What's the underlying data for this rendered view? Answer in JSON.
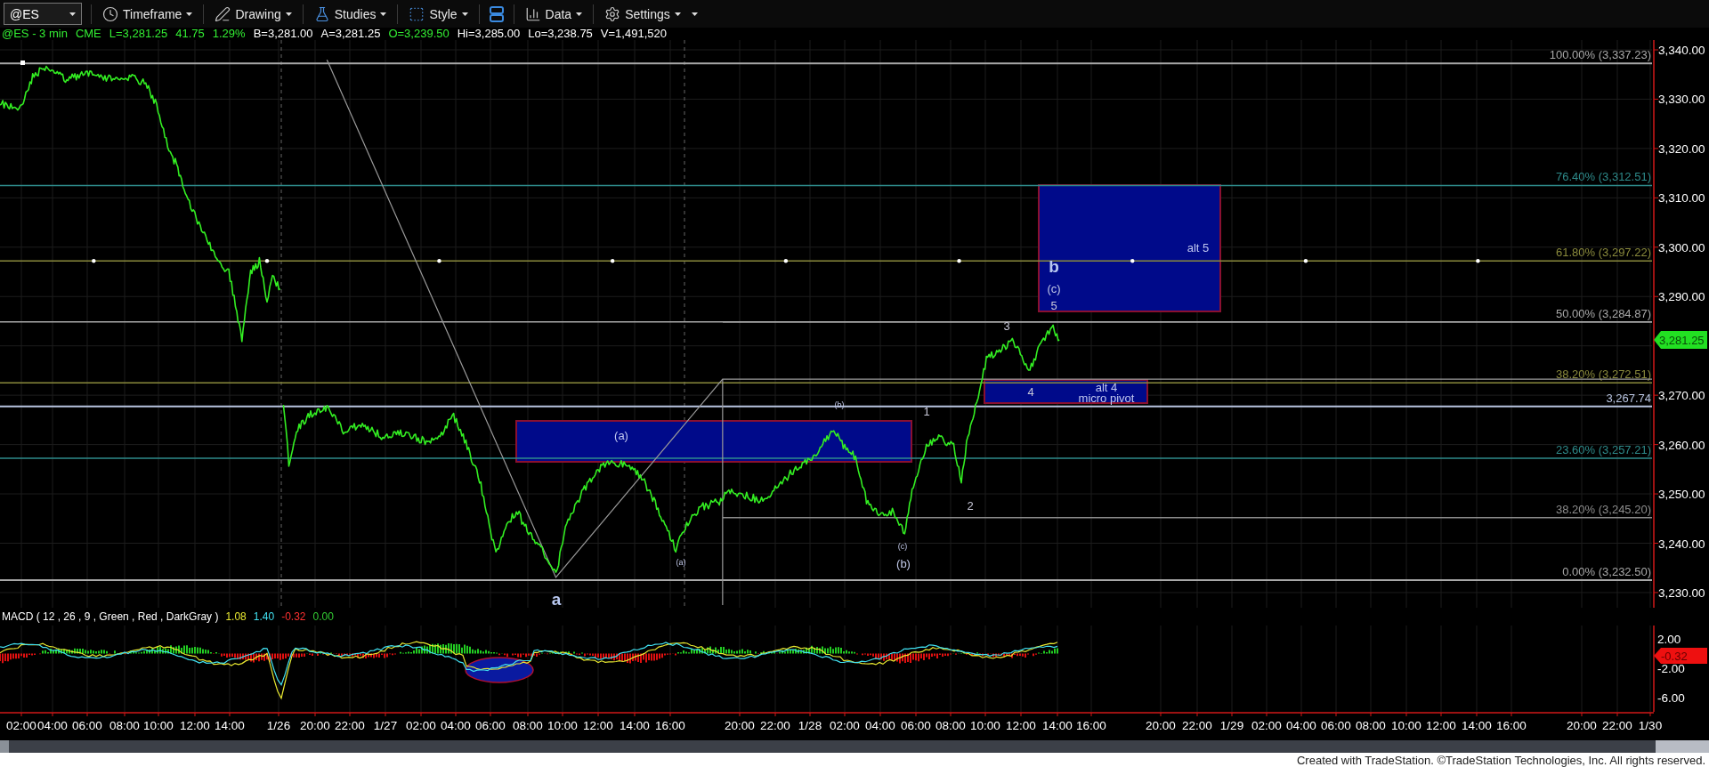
{
  "toolbar": {
    "symbol": "@ES",
    "menus": [
      {
        "label": "Timeframe",
        "kind": "clock"
      },
      {
        "label": "Drawing",
        "kind": "pen"
      },
      {
        "label": "Studies",
        "kind": "flask"
      },
      {
        "label": "Style",
        "kind": "style"
      },
      {
        "label": "Data",
        "kind": "bars"
      },
      {
        "label": "Settings",
        "kind": "gear"
      }
    ]
  },
  "quote": [
    {
      "text": "@ES - 3 min",
      "color": "#33ee33"
    },
    {
      "text": "CME",
      "color": "#33ee33"
    },
    {
      "text": "L=3,281.25",
      "color": "#33ee33"
    },
    {
      "text": "41.75",
      "color": "#33ee33"
    },
    {
      "text": "1.29%",
      "color": "#33ee33"
    },
    {
      "text": "B=3,281.00",
      "color": "#ffffff"
    },
    {
      "text": "A=3,281.25",
      "color": "#ffffff"
    },
    {
      "text": "O=3,239.50",
      "color": "#33ee33"
    },
    {
      "text": "Hi=3,285.00",
      "color": "#ffffff"
    },
    {
      "text": "Lo=3,238.75",
      "color": "#ffffff"
    },
    {
      "text": "V=1,491,520",
      "color": "#ffffff"
    }
  ],
  "chart": {
    "fib_levels": [
      {
        "label": "100.00% (3,337.23)",
        "color": "#a8a8a8"
      },
      {
        "label": "76.40% (3,312.51)",
        "color": "#2e8b8b"
      },
      {
        "label": "61.80% (3,297.22)",
        "color": "#8a8a3c"
      },
      {
        "label": "50.00% (3,284.87)",
        "color": "#a8a8a8"
      },
      {
        "label": "38.20% (3,272.51)",
        "color": "#8a8a3c"
      },
      {
        "label": "3,267.74",
        "color": "#b8c4e0"
      },
      {
        "label": "23.60% (3,257.21)",
        "color": "#2e8b8b"
      },
      {
        "label": "38.20% (3,245.20)",
        "color": "#8c8c8c"
      },
      {
        "label": "0.00% (3,232.50)",
        "color": "#a8a8a8"
      }
    ],
    "zones": [
      {
        "labels": [
          "(a)"
        ]
      },
      {
        "labels": [
          "alt 5"
        ]
      },
      {
        "labels": [
          "alt 4",
          "micro pivot"
        ]
      }
    ],
    "wave_labels": [
      {
        "text": "b",
        "kind": "major"
      },
      {
        "text": "(c)",
        "kind": "minute"
      },
      {
        "text": "5",
        "kind": "minor"
      },
      {
        "text": "3",
        "kind": "minor"
      },
      {
        "text": "4",
        "kind": "minor"
      },
      {
        "text": "(b)",
        "kind": "tiny"
      },
      {
        "text": "1",
        "kind": "minor"
      },
      {
        "text": "2",
        "kind": "minor"
      },
      {
        "text": "(c)",
        "kind": "tiny"
      },
      {
        "text": "(a)",
        "kind": "tiny"
      },
      {
        "text": "(b)",
        "kind": "minute"
      },
      {
        "text": "a",
        "kind": "major"
      }
    ],
    "price_ticks": [
      "3,340.00",
      "3,330.00",
      "3,320.00",
      "3,310.00",
      "3,300.00",
      "3,290.00",
      "3,270.00",
      "3,260.00",
      "3,250.00",
      "3,240.00",
      "3,230.00"
    ],
    "last_price": "3,281.25"
  },
  "macd": {
    "label": "MACD ( 12 , 26 , 9 , Green , Red , DarkGray )",
    "readings": [
      {
        "text": "1.08",
        "color": "#e8e830"
      },
      {
        "text": "1.40",
        "color": "#40e0f0"
      },
      {
        "text": "-0.32",
        "color": "#ff3030"
      },
      {
        "text": "0.00",
        "color": "#33cc33"
      }
    ],
    "ticks": [
      "2.00",
      "-2.00",
      "-6.00"
    ],
    "last_value": "-0.32"
  },
  "time_axis": [
    "02:00",
    "04:00",
    "06:00",
    "08:00",
    "10:00",
    "12:00",
    "14:00",
    "1/26",
    "20:00",
    "22:00",
    "1/27",
    "02:00",
    "04:00",
    "06:00",
    "08:00",
    "10:00",
    "12:00",
    "14:00",
    "16:00",
    "20:00",
    "22:00",
    "1/28",
    "02:00",
    "04:00",
    "06:00",
    "08:00",
    "10:00",
    "12:00",
    "14:00",
    "16:00",
    "20:00",
    "22:00",
    "1/29",
    "02:00",
    "04:00",
    "06:00",
    "08:00",
    "10:00",
    "12:00",
    "14:00",
    "16:00",
    "20:00",
    "22:00",
    "1/30"
  ],
  "footer": "Created with TradeStation. ©TradeStation Technologies, Inc. All rights reserved."
}
